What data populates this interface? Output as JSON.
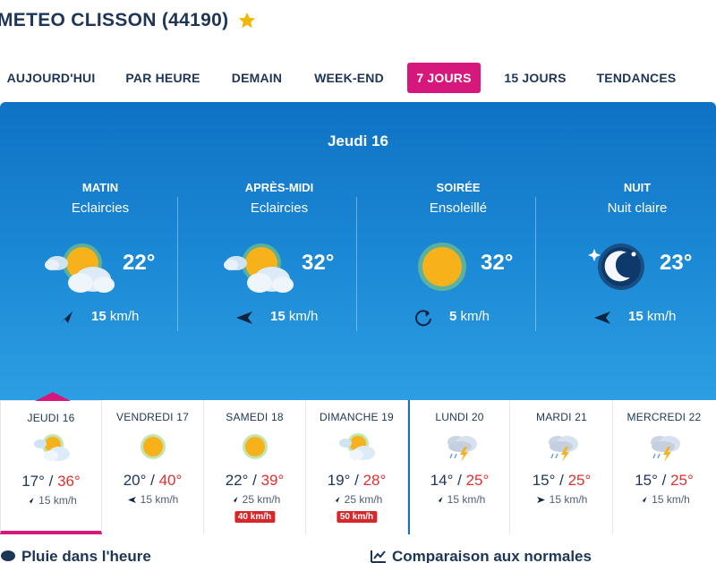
{
  "header": {
    "title": "METEO CLISSON (44190)",
    "favorite_icon": "star-icon",
    "favorite_color": "#f2b705"
  },
  "tabs": [
    {
      "label": "AUJOURD'HUI",
      "active": false
    },
    {
      "label": "PAR HEURE",
      "active": false
    },
    {
      "label": "DEMAIN",
      "active": false
    },
    {
      "label": "WEEK-END",
      "active": false
    },
    {
      "label": "7 JOURS",
      "active": true
    },
    {
      "label": "15 JOURS",
      "active": false
    },
    {
      "label": "TENDANCES",
      "active": false
    }
  ],
  "selected_day": {
    "title": "Jeudi 16",
    "periods": [
      {
        "name": "MATIN",
        "condition": "Eclaircies",
        "icon": "partly-cloudy-icon",
        "temp": "22°",
        "wind_icon": "wind-arrow-icon",
        "wind_value": "15",
        "wind_unit": "km/h"
      },
      {
        "name": "APRÈS-MIDI",
        "condition": "Eclaircies",
        "icon": "partly-cloudy-icon",
        "temp": "32°",
        "wind_icon": "wind-arrow-icon",
        "wind_value": "15",
        "wind_unit": "km/h"
      },
      {
        "name": "SOIRÉE",
        "condition": "Ensoleillé",
        "icon": "sun-icon",
        "temp": "32°",
        "wind_icon": "variable-wind-icon",
        "wind_value": "5",
        "wind_unit": "km/h"
      },
      {
        "name": "NUIT",
        "condition": "Nuit claire",
        "icon": "moon-icon",
        "temp": "23°",
        "wind_icon": "wind-arrow-icon",
        "wind_value": "15",
        "wind_unit": "km/h"
      }
    ]
  },
  "forecast": [
    {
      "day": "JEUDI 16",
      "icon": "partly-cloudy-icon",
      "min": "17°",
      "max": "36°",
      "wind": "15 km/h",
      "gust": "",
      "selected": true
    },
    {
      "day": "VENDREDI 17",
      "icon": "sun-icon",
      "min": "20°",
      "max": "40°",
      "wind": "15 km/h",
      "gust": "",
      "selected": false
    },
    {
      "day": "SAMEDI 18",
      "icon": "sun-icon",
      "min": "22°",
      "max": "39°",
      "wind": "25 km/h",
      "gust": "40 km/h",
      "selected": false
    },
    {
      "day": "DIMANCHE 19",
      "icon": "partly-cloudy-icon",
      "min": "19°",
      "max": "28°",
      "wind": "25 km/h",
      "gust": "50 km/h",
      "selected": false
    },
    {
      "day": "LUNDI 20",
      "icon": "thunderstorm-icon",
      "min": "14°",
      "max": "25°",
      "wind": "15 km/h",
      "gust": "",
      "selected": false
    },
    {
      "day": "MARDI 21",
      "icon": "thunderstorm-icon",
      "min": "15°",
      "max": "25°",
      "wind": "15 km/h",
      "gust": "",
      "selected": false
    },
    {
      "day": "MERCREDI 22",
      "icon": "thunderstorm-icon",
      "min": "15°",
      "max": "25°",
      "wind": "15 km/h",
      "gust": "",
      "selected": false
    }
  ],
  "sections": {
    "rain_title": "Pluie dans l'heure",
    "comparison_title": "Comparaison aux normales"
  },
  "colors": {
    "accent": "#d6177c",
    "max_temp": "#e0312f",
    "gust_badge": "#d6282b",
    "hero_top": "#0f72c4",
    "hero_bottom": "#2d9ee3",
    "text": "#1d3557"
  }
}
